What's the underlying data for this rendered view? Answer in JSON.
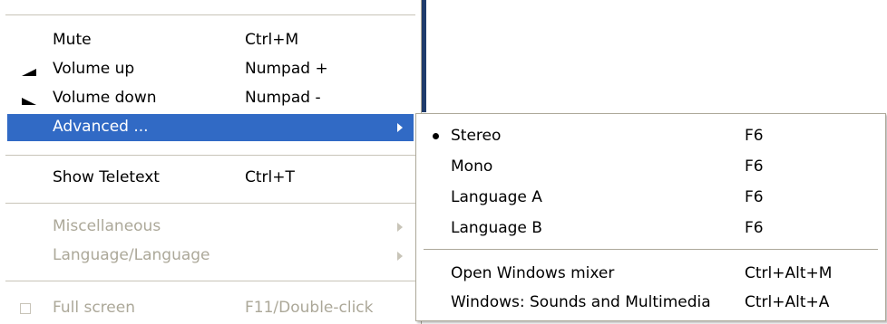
{
  "main_menu": {
    "items": [
      {
        "label": "Mute",
        "shortcut": "Ctrl+M"
      },
      {
        "label": "Volume up",
        "shortcut": "Numpad +",
        "icon": "volume-up-icon"
      },
      {
        "label": "Volume down",
        "shortcut": "Numpad -",
        "icon": "volume-down-icon"
      },
      {
        "label": "Advanced ...",
        "shortcut": "",
        "selected": true
      },
      {
        "label": "Show Teletext",
        "shortcut": "Ctrl+T"
      },
      {
        "label": "Miscellaneous",
        "shortcut": "",
        "disabled": true
      },
      {
        "label": "Language/Language",
        "shortcut": "",
        "disabled": true
      },
      {
        "label": "Full screen",
        "shortcut": "F11/Double-click",
        "disabled": true
      }
    ]
  },
  "sub_menu": {
    "items": [
      {
        "label": "Stereo",
        "shortcut": "F6",
        "checked": true
      },
      {
        "label": "Mono",
        "shortcut": "F6"
      },
      {
        "label": "Language A",
        "shortcut": "F6"
      },
      {
        "label": "Language B",
        "shortcut": "F6"
      },
      {
        "label": "Open Windows mixer",
        "shortcut": "Ctrl+Alt+M"
      },
      {
        "label": "Windows: Sounds and Multimedia",
        "shortcut": "Ctrl+Alt+A"
      }
    ]
  },
  "colors": {
    "highlight": "#316ac5",
    "disabled_text": "#aca899",
    "dark_bar": "#1f3b6b"
  }
}
